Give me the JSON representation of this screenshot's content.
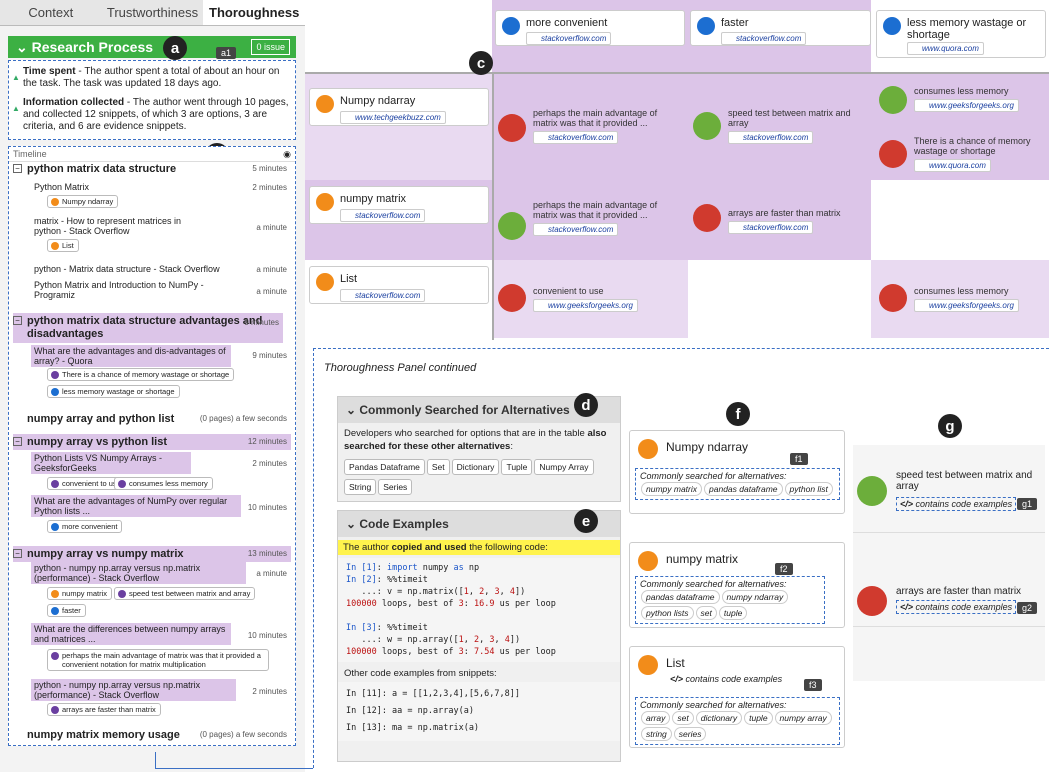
{
  "tabs": [
    "Context",
    "Trustworthiness",
    "Thoroughness"
  ],
  "research": {
    "title": "Research Process",
    "badge": "0 issue",
    "time_bold": "Time spent",
    "time_text": " - The author spent a total of about an hour on the task. The task was updated 18 days ago.",
    "info_bold": "Information collected",
    "info_text": " - The author went through 10 pages, and collected 12 snippets, of which 3 are options, 3 are criteria, and 6 are evidence snippets."
  },
  "timeline": {
    "header": "Timeline",
    "groups": [
      {
        "title": "python matrix data structure",
        "time": "5 minutes"
      },
      {
        "title": "python matrix data structure advantages and disadvantages",
        "time": "9 minutes"
      },
      {
        "title": "numpy array and python list",
        "time": "(0 pages)  a few seconds"
      },
      {
        "title": "numpy array vs python list",
        "time": "12 minutes"
      },
      {
        "title": "numpy array vs numpy matrix",
        "time": "13 minutes"
      },
      {
        "title": "numpy matrix memory usage",
        "time": "(0 pages)  a few seconds"
      }
    ],
    "items": [
      {
        "title": "Python Matrix",
        "time": "2 minutes"
      },
      {
        "title": "matrix - How to represent matrices in python - Stack Overflow",
        "time": "a minute"
      },
      {
        "title": "python - Matrix data structure - Stack Overflow",
        "time": "a minute"
      },
      {
        "title": "Python Matrix and Introduction to NumPy - Programiz",
        "time": "a minute"
      },
      {
        "title": "What are the advantages and dis-advantages of array? - Quora",
        "time": "9 minutes"
      },
      {
        "title": "Python Lists VS Numpy Arrays - GeeksforGeeks",
        "time": "2 minutes"
      },
      {
        "title": "What are the advantages of NumPy over regular Python lists ...",
        "time": "10 minutes"
      },
      {
        "title": "python - numpy np.array versus np.matrix (performance) - Stack Overflow",
        "time": "a minute"
      },
      {
        "title": "What are the differences between numpy arrays and matrices ...",
        "time": "10 minutes"
      },
      {
        "title": "python - numpy np.array versus np.matrix (performance) - Stack Overflow",
        "time": "2 minutes"
      }
    ],
    "chips": [
      "Numpy ndarray",
      "List",
      "There is a chance of memory wastage or shortage",
      "less memory wastage or shortage",
      "convenient to use",
      "consumes less memory",
      "more convenient",
      "numpy matrix",
      "speed test between matrix and array",
      "faster",
      "perhaps the main advantage of matrix was that it provided a convenient notation for matrix multiplication",
      "arrays are faster than matrix"
    ]
  },
  "labels": {
    "a": "a",
    "a1": "a1",
    "b": "b",
    "c": "c",
    "d": "d",
    "e": "e",
    "f": "f",
    "g": "g",
    "f1": "f1",
    "f2": "f2",
    "f3": "f3",
    "g1": "g1",
    "g2": "g2"
  },
  "grid": {
    "criteria": [
      {
        "name": "more convenient",
        "src": "stackoverflow.com"
      },
      {
        "name": "faster",
        "src": "stackoverflow.com"
      },
      {
        "name": "less memory wastage or shortage",
        "src": "www.quora.com"
      }
    ],
    "options": [
      {
        "name": "Numpy ndarray",
        "src": "www.techgeekbuzz.com"
      },
      {
        "name": "numpy matrix",
        "src": "stackoverflow.com"
      },
      {
        "name": "List",
        "src": "stackoverflow.com"
      }
    ],
    "evidence": [
      {
        "text": "perhaps the main advantage of matrix was that it provided ...",
        "src": "stackoverflow.com"
      },
      {
        "text": "speed test between matrix and array",
        "src": "stackoverflow.com"
      },
      {
        "text": "consumes less memory",
        "src": "www.geeksforgeeks.org"
      },
      {
        "text": "There is a chance of memory wastage or shortage",
        "src": "www.quora.com"
      },
      {
        "text": "perhaps the main advantage of matrix was that it provided ...",
        "src": "stackoverflow.com"
      },
      {
        "text": "arrays are faster than matrix",
        "src": "stackoverflow.com"
      },
      {
        "text": "convenient to use",
        "src": "www.geeksforgeeks.org"
      },
      {
        "text": "consumes less memory",
        "src": "www.geeksforgeeks.org"
      }
    ]
  },
  "continued": "Thoroughness Panel continued",
  "alternatives": {
    "title": "Commonly Searched for Alternatives",
    "desc1": "Developers who searched for options that are in the table ",
    "desc_bold": "also searched for these other alternatives",
    "desc2": ":",
    "tags": [
      "Pandas Dataframe",
      "Set",
      "Dictionary",
      "Tuple",
      "Numpy Array",
      "String",
      "Series"
    ]
  },
  "code": {
    "title": "Code Examples",
    "hl1": "The author ",
    "hl_bold": "copied and used",
    "hl2": " the following code:",
    "other": "Other code examples from snippets:",
    "snip1": "In [11]: a = [[1,2,3,4],[5,6,7,8]]",
    "snip2": "In [12]: aa = np.array(a)",
    "snip3": "In [13]: ma = np.matrix(a)"
  },
  "fcards": [
    {
      "name": "Numpy ndarray",
      "alt_label": "Commonly searched for alternatives:",
      "tags": [
        "numpy matrix",
        "pandas dataframe",
        "python list"
      ]
    },
    {
      "name": "numpy matrix",
      "alt_label": "Commonly searched for alternatives:",
      "tags": [
        "pandas dataframe",
        "numpy ndarray",
        "python lists",
        "set",
        "tuple"
      ]
    },
    {
      "name": "List",
      "code_label": "contains code examples",
      "alt_label": "Commonly searched for alternatives:",
      "tags": [
        "array",
        "set",
        "dictionary",
        "tuple",
        "numpy array",
        "string",
        "series"
      ]
    }
  ],
  "gcards": [
    {
      "text": "speed test between matrix and array",
      "code_label": "contains code examples"
    },
    {
      "text": "arrays are faster than matrix",
      "code_label": "contains code examples"
    }
  ]
}
